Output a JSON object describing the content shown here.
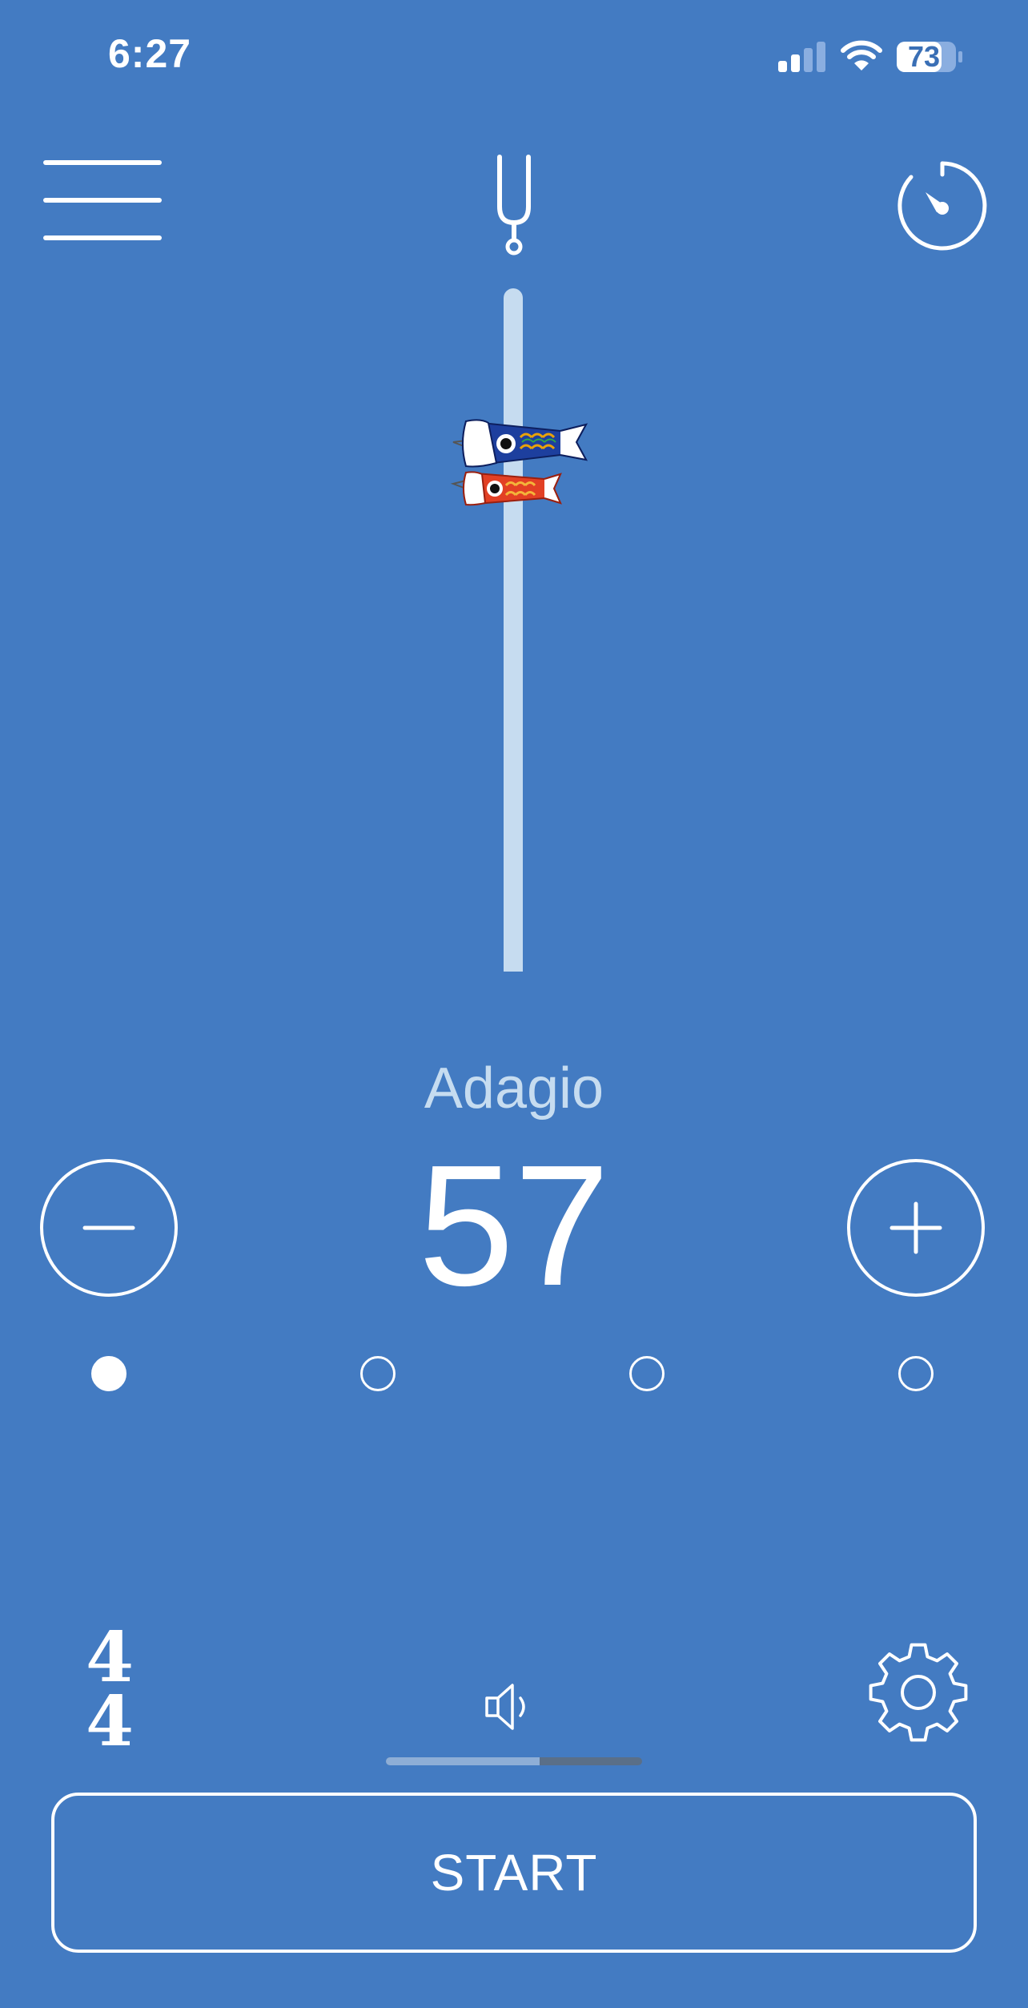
{
  "status_bar": {
    "time": "6:27",
    "battery_percent": "73",
    "icons": [
      "signal-icon",
      "wifi-icon",
      "battery-icon"
    ]
  },
  "toolbar": {
    "icons": [
      "menu-icon",
      "tuning-fork-icon",
      "timer-icon"
    ]
  },
  "pendulum": {
    "icon": "koinobori-icon"
  },
  "tempo": {
    "name": "Adagio",
    "bpm": "57"
  },
  "beats": {
    "count": 4,
    "accented_index": 0
  },
  "time_signature": {
    "numerator": "4",
    "denominator": "4"
  },
  "volume": {
    "level": 0.6,
    "icon": "speaker-icon"
  },
  "settings": {
    "icon": "gear-icon"
  },
  "start_button": {
    "label": "START"
  },
  "colors": {
    "background": "#437bc2",
    "track": "#c6dcf0",
    "tempo_name": "#c6dcf0"
  }
}
